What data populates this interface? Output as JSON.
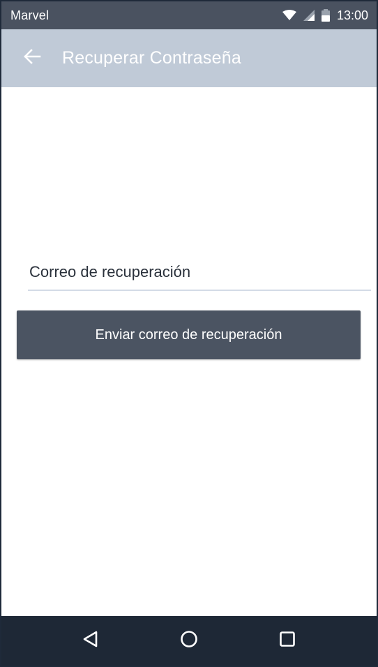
{
  "status_bar": {
    "carrier": "Marvel",
    "time": "13:00",
    "icons": [
      "wifi-icon",
      "signal-icon",
      "battery-icon"
    ]
  },
  "app_bar": {
    "back_icon": "arrow-left-icon",
    "title": "Recuperar Contraseña"
  },
  "form": {
    "email_placeholder": "Correo de recuperación",
    "email_value": "",
    "submit_label": "Enviar correo de recuperación"
  },
  "nav_bar": {
    "icons": [
      "back-triangle-icon",
      "home-circle-icon",
      "recents-square-icon"
    ]
  },
  "colors": {
    "status_bar": "#4a5260",
    "app_bar": "#c0cad7",
    "button": "#4b5462",
    "nav_bar": "#1e2836",
    "input_underline": "#d3dbe6"
  }
}
